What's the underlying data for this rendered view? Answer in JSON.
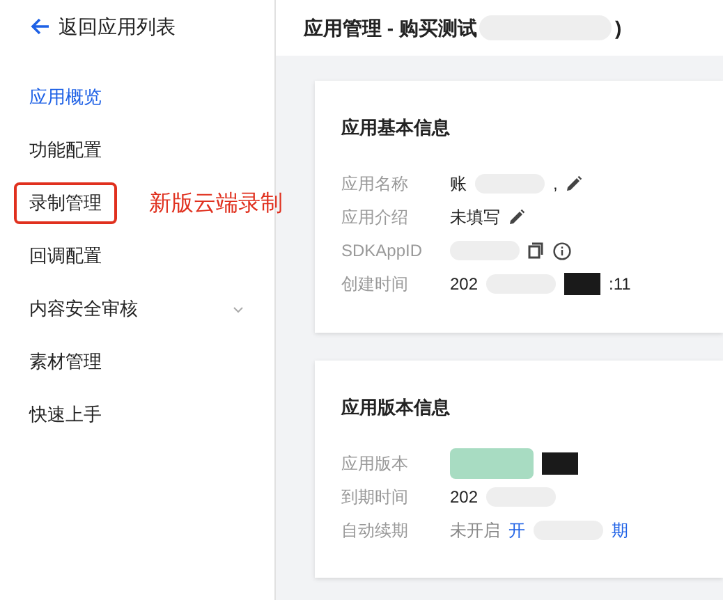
{
  "back_link": "返回应用列表",
  "sidebar": {
    "items": [
      {
        "label": "应用概览",
        "selected": true,
        "highlighted": false,
        "expandable": false
      },
      {
        "label": "功能配置",
        "selected": false,
        "highlighted": false,
        "expandable": false
      },
      {
        "label": "录制管理",
        "selected": false,
        "highlighted": true,
        "expandable": false
      },
      {
        "label": "回调配置",
        "selected": false,
        "highlighted": false,
        "expandable": false
      },
      {
        "label": "内容安全审核",
        "selected": false,
        "highlighted": false,
        "expandable": true
      },
      {
        "label": "素材管理",
        "selected": false,
        "highlighted": false,
        "expandable": false
      },
      {
        "label": "快速上手",
        "selected": false,
        "highlighted": false,
        "expandable": false
      }
    ]
  },
  "annotation": "新版云端录制",
  "page_title": "应用管理 - 购买测试",
  "page_title_tail": ")",
  "cards": [
    {
      "title": "应用基本信息",
      "rows": [
        {
          "label": "应用名称",
          "parts": [
            {
              "kind": "text",
              "text": "账"
            },
            {
              "kind": "blot"
            },
            {
              "kind": "text",
              "text": ","
            },
            {
              "kind": "edit"
            }
          ]
        },
        {
          "label": "应用介绍",
          "parts": [
            {
              "kind": "text",
              "text": "未填写"
            },
            {
              "kind": "edit"
            }
          ]
        },
        {
          "label": "SDKAppID",
          "parts": [
            {
              "kind": "blot"
            },
            {
              "kind": "copy"
            },
            {
              "kind": "info"
            }
          ]
        },
        {
          "label": "创建时间",
          "parts": [
            {
              "kind": "text",
              "text": "202"
            },
            {
              "kind": "blot"
            },
            {
              "kind": "darkblot"
            },
            {
              "kind": "text",
              "text": ":11"
            }
          ]
        }
      ]
    },
    {
      "title": "应用版本信息",
      "rows": [
        {
          "label": "应用版本",
          "parts": [
            {
              "kind": "greenblot"
            },
            {
              "kind": "darkblot"
            }
          ]
        },
        {
          "label": "到期时间",
          "parts": [
            {
              "kind": "text",
              "text": "202"
            },
            {
              "kind": "blot"
            }
          ]
        },
        {
          "label": "自动续期",
          "parts": [
            {
              "kind": "muted",
              "text": "未开启"
            },
            {
              "kind": "link",
              "text": "开"
            },
            {
              "kind": "blot"
            },
            {
              "kind": "link",
              "text": "期"
            }
          ]
        }
      ]
    }
  ]
}
